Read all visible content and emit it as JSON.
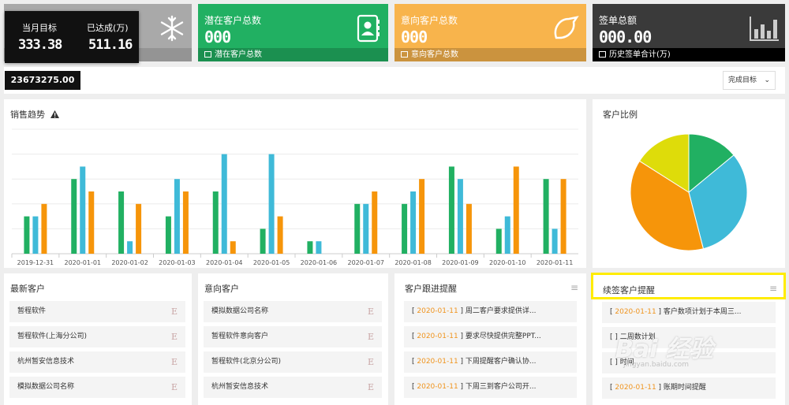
{
  "cards": [
    {
      "title": "",
      "value": "",
      "footer": "",
      "color": "#a9a9a9"
    },
    {
      "title": "潜在客户总数",
      "value": "000",
      "footer": "潜在客户总数",
      "color": "#21b062"
    },
    {
      "title": "意向客户总数",
      "value": "000",
      "footer": "意向客户总数",
      "color": "#f8b44c"
    },
    {
      "title": "签单总额",
      "value": "000.00",
      "footer": "历史签单合计(万)",
      "color": "#3a3a3a"
    }
  ],
  "tooltip": {
    "target_label": "当月目标",
    "done_label": "已达成(万)",
    "target_value": "333.38",
    "done_value": "511.16",
    "total": "23673275.00"
  },
  "filter": {
    "label": "完成目标"
  },
  "sales_panel": {
    "title": "销售趋势"
  },
  "ratio_panel": {
    "title": "客户比例"
  },
  "chart_data": {
    "type": "bar",
    "categories": [
      "2019-12-31",
      "2020-01-01",
      "2020-01-02",
      "2020-01-03",
      "2020-01-04",
      "2020-01-05",
      "2020-01-06",
      "2020-01-07",
      "2020-01-08",
      "2020-01-09",
      "2020-01-10",
      "2020-01-11"
    ],
    "series": [
      {
        "color": "#21b062",
        "values": [
          3,
          6,
          5,
          3,
          5,
          2,
          1,
          4,
          4,
          7,
          2,
          6
        ]
      },
      {
        "color": "#3fbad8",
        "values": [
          3,
          7,
          1,
          6,
          8,
          8,
          1,
          4,
          5,
          6,
          3,
          2
        ]
      },
      {
        "color": "#f6950a",
        "values": [
          4,
          5,
          4,
          5,
          1,
          3,
          0,
          5,
          6,
          4,
          7,
          6
        ]
      }
    ],
    "ylim": [
      0,
      10
    ],
    "grid": true
  },
  "pie_data": {
    "type": "pie",
    "slices": [
      {
        "value": 14,
        "color": "#21b062"
      },
      {
        "value": 32,
        "color": "#3fbad8"
      },
      {
        "value": 38,
        "color": "#f6950a"
      },
      {
        "value": 16,
        "color": "#dedc0a"
      }
    ]
  },
  "panels": [
    {
      "title": "最新客户",
      "items": [
        "暂程软件",
        "暂程软件(上海分公司)",
        "杭州暂安信息技术",
        "模拟数据公司名称"
      ],
      "mark": "E"
    },
    {
      "title": "意向客户",
      "items": [
        "模拟数据公司名称",
        "暂程软件意向客户",
        "暂程软件(北京分公司)",
        "杭州暂安信息技术"
      ],
      "mark": "E"
    },
    {
      "title": "客户跟进提醒",
      "items": [
        {
          "date": "2020-01-11",
          "text": "周二客户要求提供详..."
        },
        {
          "date": "2020-01-11",
          "text": "要求尽快提供完整PPT..."
        },
        {
          "date": "2020-01-11",
          "text": "下周提醒客户确认协..."
        },
        {
          "date": "2020-01-11",
          "text": "下周三到客户公司开..."
        }
      ]
    },
    {
      "title": "续签客户提醒",
      "items": [
        {
          "date": "2020-01-11",
          "text": "客户数项计划于本周三..."
        },
        {
          "date": "",
          "text": "二周数计划"
        },
        {
          "date": "",
          "text": "时间"
        },
        {
          "date": "2020-01-11",
          "text": "账期时间提醒"
        }
      ]
    }
  ],
  "watermark": {
    "brand": "Bai 经验",
    "url": "jingyan.baidu.com"
  }
}
